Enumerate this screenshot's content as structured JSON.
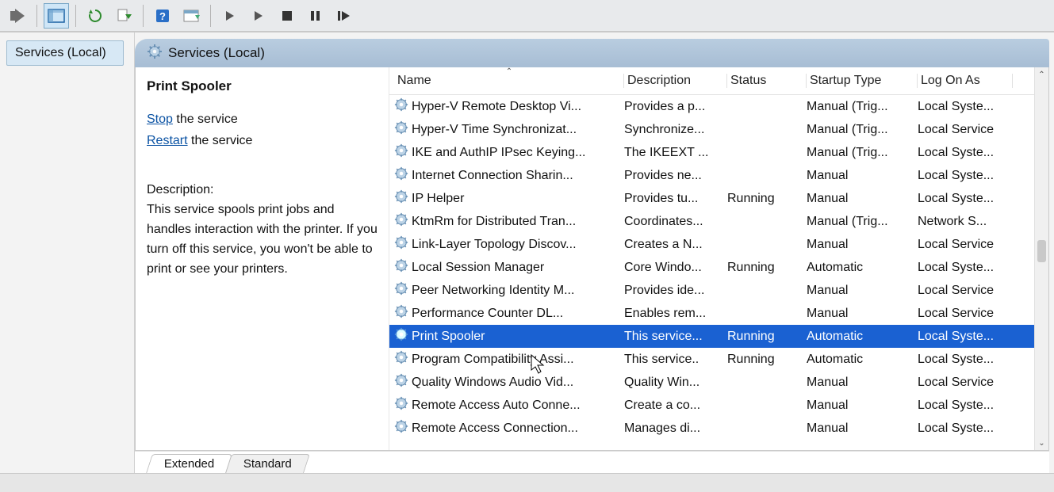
{
  "sidebar": {
    "tab_label": "Services (Local)"
  },
  "panel_title": "Services (Local)",
  "detail": {
    "title": "Print Spooler",
    "stop_link": "Stop",
    "stop_suffix": " the service",
    "restart_link": "Restart",
    "restart_suffix": " the service",
    "desc_label": "Description:",
    "description": "This service spools print jobs and handles interaction with the printer. If you turn off this service, you won't be able to print or see your printers."
  },
  "columns": {
    "name": "Name",
    "description": "Description",
    "status": "Status",
    "startup": "Startup Type",
    "logon": "Log On As"
  },
  "sorted_column": "name",
  "rows": [
    {
      "name": "Hyper-V Remote Desktop Vi...",
      "description": "Provides a p...",
      "status": "",
      "startup": "Manual (Trig...",
      "logon": "Local Syste...",
      "selected": false
    },
    {
      "name": "Hyper-V Time Synchronizat...",
      "description": "Synchronize...",
      "status": "",
      "startup": "Manual (Trig...",
      "logon": "Local Service",
      "selected": false
    },
    {
      "name": "IKE and AuthIP IPsec Keying...",
      "description": "The IKEEXT ...",
      "status": "",
      "startup": "Manual (Trig...",
      "logon": "Local Syste...",
      "selected": false
    },
    {
      "name": "Internet Connection Sharin...",
      "description": "Provides ne...",
      "status": "",
      "startup": "Manual",
      "logon": "Local Syste...",
      "selected": false
    },
    {
      "name": "IP Helper",
      "description": "Provides tu...",
      "status": "Running",
      "startup": "Manual",
      "logon": "Local Syste...",
      "selected": false
    },
    {
      "name": "KtmRm for Distributed Tran...",
      "description": "Coordinates...",
      "status": "",
      "startup": "Manual (Trig...",
      "logon": "Network S...",
      "selected": false
    },
    {
      "name": "Link-Layer Topology Discov...",
      "description": "Creates a N...",
      "status": "",
      "startup": "Manual",
      "logon": "Local Service",
      "selected": false
    },
    {
      "name": "Local Session Manager",
      "description": "Core Windo...",
      "status": "Running",
      "startup": "Automatic",
      "logon": "Local Syste...",
      "selected": false
    },
    {
      "name": "Peer Networking Identity M...",
      "description": "Provides ide...",
      "status": "",
      "startup": "Manual",
      "logon": "Local Service",
      "selected": false
    },
    {
      "name": "Performance Counter DL...",
      "description": "Enables rem...",
      "status": "",
      "startup": "Manual",
      "logon": "Local Service",
      "selected": false
    },
    {
      "name": "Print Spooler",
      "description": "This service...",
      "status": "Running",
      "startup": "Automatic",
      "logon": "Local Syste...",
      "selected": true
    },
    {
      "name": "Program Compatibility Assi...",
      "description": "This service..",
      "status": "Running",
      "startup": "Automatic",
      "logon": "Local Syste...",
      "selected": false
    },
    {
      "name": "Quality Windows Audio Vid...",
      "description": "Quality Win...",
      "status": "",
      "startup": "Manual",
      "logon": "Local Service",
      "selected": false
    },
    {
      "name": "Remote Access Auto Conne...",
      "description": "Create a co...",
      "status": "",
      "startup": "Manual",
      "logon": "Local Syste...",
      "selected": false
    },
    {
      "name": "Remote Access Connection...",
      "description": "Manages di...",
      "status": "",
      "startup": "Manual",
      "logon": "Local Syste...",
      "selected": false
    }
  ],
  "tabs": {
    "extended": "Extended",
    "standard": "Standard"
  }
}
